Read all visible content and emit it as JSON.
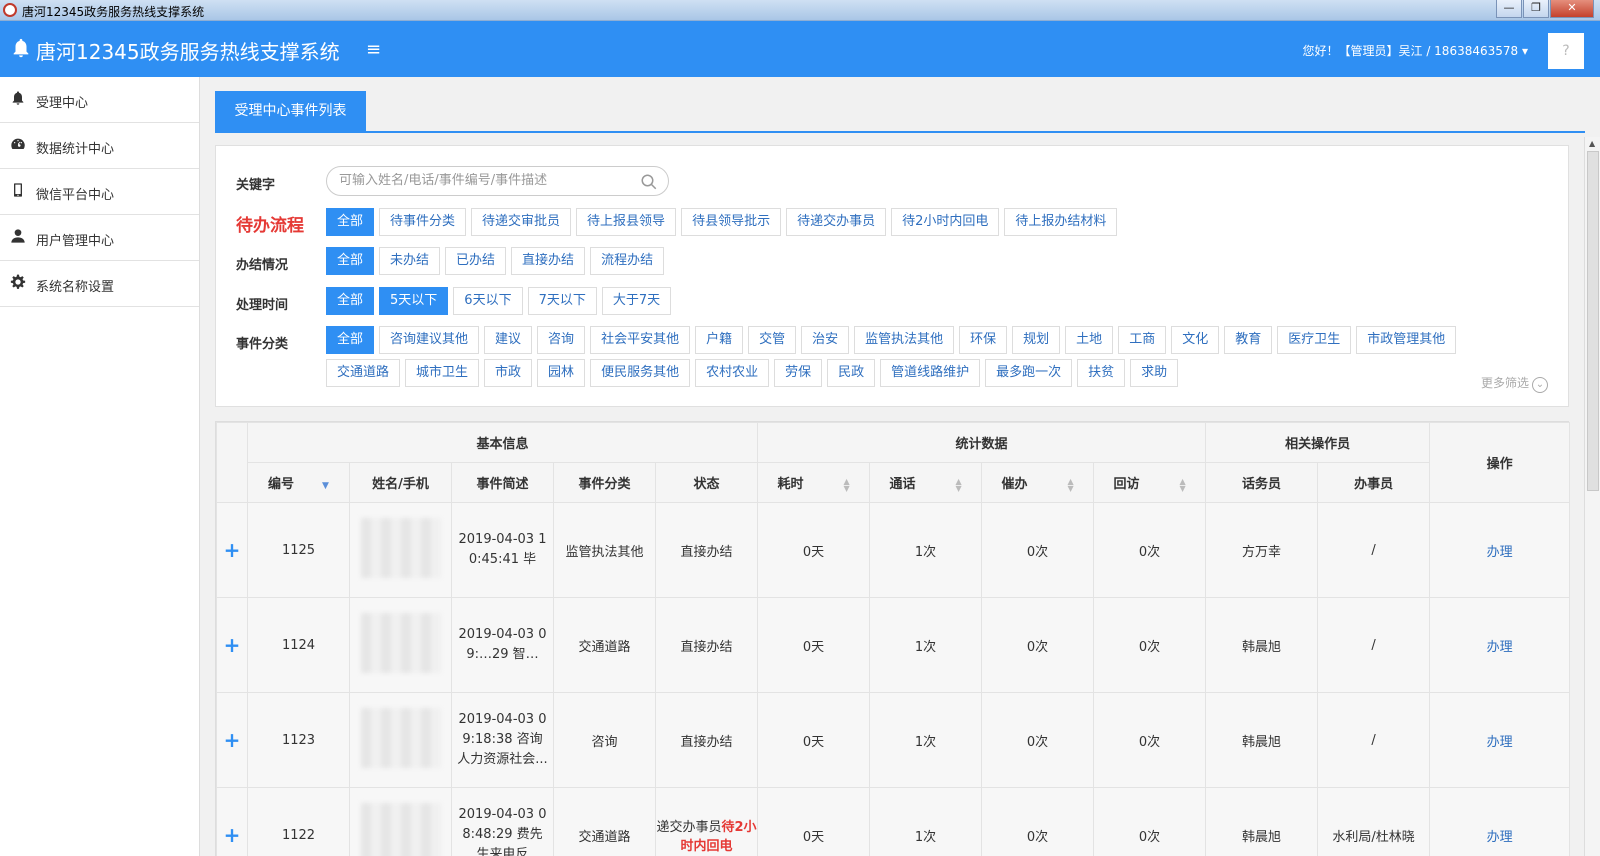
{
  "window": {
    "title": "唐河12345政务服务热线支撑系统",
    "minimize": "—",
    "restore": "❐",
    "close": "✕"
  },
  "header": {
    "title": "唐河12345政务服务热线支撑系统",
    "menu_icon": "≡",
    "greeting": "您好！【管理员】吴江 / 18638463578 ▾",
    "help": "?"
  },
  "sidebar": {
    "items": [
      {
        "label": "受理中心",
        "icon": "bell-icon"
      },
      {
        "label": "数据统计中心",
        "icon": "dashboard-icon"
      },
      {
        "label": "微信平台中心",
        "icon": "mobile-icon"
      },
      {
        "label": "用户管理中心",
        "icon": "user-icon"
      },
      {
        "label": "系统名称设置",
        "icon": "gear-icon"
      }
    ]
  },
  "tab": {
    "label": "受理中心事件列表"
  },
  "filters": {
    "keyword_label": "关键字",
    "keyword_placeholder": "可输入姓名/电话/事件编号/事件描述",
    "flow_label": "待办流程",
    "flow_options": [
      "全部",
      "待事件分类",
      "待递交审批员",
      "待上报县领导",
      "待县领导批示",
      "待递交办事员",
      "待2小时内回电",
      "待上报办结材料"
    ],
    "done_label": "办结情况",
    "done_options": [
      "全部",
      "未办结",
      "已办结",
      "直接办结",
      "流程办结"
    ],
    "time_label": "处理时间",
    "time_options": [
      "全部",
      "5天以下",
      "6天以下",
      "7天以下",
      "大于7天"
    ],
    "category_label": "事件分类",
    "category_row1": [
      "全部",
      "咨询建议其他",
      "建议",
      "咨询",
      "社会平安其他",
      "户籍",
      "交管",
      "治安",
      "监管执法其他",
      "环保",
      "规划",
      "土地",
      "工商",
      "文化",
      "教育",
      "医疗卫生",
      "市政管理其他"
    ],
    "category_row2": [
      "交通道路",
      "城市卫生",
      "市政",
      "园林",
      "便民服务其他",
      "农村农业",
      "劳保",
      "民政",
      "管道线路维护",
      "最多跑一次",
      "扶贫",
      "求助"
    ],
    "more_label": "更多筛选"
  },
  "table": {
    "group_headers": {
      "basic": "基本信息",
      "stats": "统计数据",
      "operators": "相关操作员"
    },
    "columns": {
      "id": "编号",
      "name": "姓名/手机",
      "desc": "事件简述",
      "category": "事件分类",
      "status": "状态",
      "duration": "耗时",
      "calls": "通话",
      "urge": "催办",
      "revisit": "回访",
      "operator": "话务员",
      "handler": "办事员",
      "action": "操作"
    },
    "expand_symbol": "+",
    "rows": [
      {
        "id": "1125",
        "desc": "2019-04-03 10:45:41 毕",
        "category": "监管执法其他",
        "status": "直接办结",
        "status_red": "",
        "duration": "0天",
        "calls": "1次",
        "urge": "0次",
        "revisit": "0次",
        "operator": "方万幸",
        "handler": "/",
        "action": "办理"
      },
      {
        "id": "1124",
        "desc": "2019-04-03 09:…29 智…",
        "category": "交通道路",
        "status": "直接办结",
        "status_red": "",
        "duration": "0天",
        "calls": "1次",
        "urge": "0次",
        "revisit": "0次",
        "operator": "韩晨旭",
        "handler": "/",
        "action": "办理"
      },
      {
        "id": "1123",
        "desc": "2019-04-03 09:18:38 咨询人力资源社会...",
        "category": "咨询",
        "status": "直接办结",
        "status_red": "",
        "duration": "0天",
        "calls": "1次",
        "urge": "0次",
        "revisit": "0次",
        "operator": "韩晨旭",
        "handler": "/",
        "action": "办理"
      },
      {
        "id": "1122",
        "desc": "2019-04-03 08:48:29 费先生来电反",
        "category": "交通道路",
        "status": "递交办事员",
        "status_red": "待2小时内回电",
        "duration": "0天",
        "calls": "1次",
        "urge": "0次",
        "revisit": "0次",
        "operator": "韩晨旭",
        "handler": "水利局/杜林晓",
        "action": "办理"
      }
    ]
  }
}
